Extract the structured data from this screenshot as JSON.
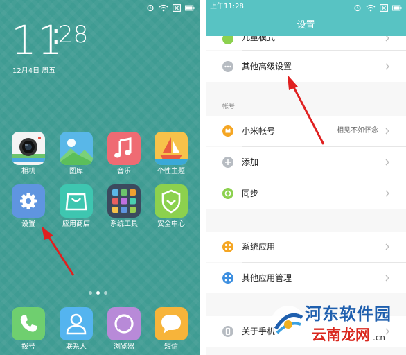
{
  "home": {
    "clock_hour": "11",
    "clock_colon": ":",
    "clock_minute": "28",
    "date": "12月4日 周五",
    "apps": [
      {
        "label": "相机",
        "icon": "camera-icon"
      },
      {
        "label": "图库",
        "icon": "gallery-icon"
      },
      {
        "label": "音乐",
        "icon": "music-icon"
      },
      {
        "label": "个性主题",
        "icon": "theme-icon"
      },
      {
        "label": "设置",
        "icon": "settings-gear-icon"
      },
      {
        "label": "应用商店",
        "icon": "app-store-bag-icon"
      },
      {
        "label": "系统工具",
        "icon": "system-tools-folder-icon"
      },
      {
        "label": "安全中心",
        "icon": "security-shield-icon"
      }
    ],
    "dock": [
      {
        "label": "拨号",
        "icon": "phone-icon"
      },
      {
        "label": "联系人",
        "icon": "contacts-icon"
      },
      {
        "label": "浏览器",
        "icon": "browser-icon"
      },
      {
        "label": "短信",
        "icon": "sms-icon"
      }
    ]
  },
  "settings": {
    "status_time": "上午11:28",
    "title": "设置",
    "partial_top_item": "儿童模式",
    "items_top": [
      {
        "label": "其他高级设置",
        "icon": "more-dots-icon"
      }
    ],
    "section_account": "帐号",
    "items_account": [
      {
        "label": "小米帐号",
        "value": "相见不如怀念",
        "icon": "mi-account-icon"
      },
      {
        "label": "添加",
        "value": "",
        "icon": "add-icon"
      },
      {
        "label": "同步",
        "value": "",
        "icon": "sync-icon"
      }
    ],
    "items_apps": [
      {
        "label": "系统应用",
        "icon": "system-apps-icon"
      },
      {
        "label": "其他应用管理",
        "icon": "app-manage-icon"
      }
    ],
    "items_bottom": [
      {
        "label": "关于手机",
        "icon": "about-phone-icon"
      }
    ]
  },
  "watermark": {
    "line1": "河东软件园",
    "line2": "云南龙网",
    "line3": ".cn"
  },
  "colors": {
    "home_bg": "#3f9c93",
    "settings_header": "#58c3c3",
    "arrow_red": "#e02020",
    "watermark_blue": "#1f5fae",
    "watermark_red": "#d9281f"
  }
}
